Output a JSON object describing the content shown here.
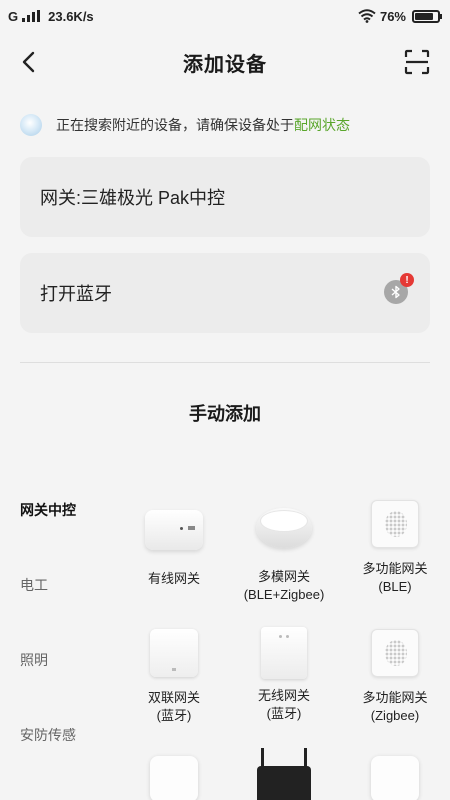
{
  "status_bar": {
    "carrier": "G",
    "speed": "23.6K/s",
    "battery": "76%",
    "battery_level": 0.76
  },
  "header": {
    "title": "添加设备",
    "back_icon": "chevron-left-icon",
    "scan_icon": "scan-icon"
  },
  "search": {
    "text": "正在搜索附近的设备，请确保设备处于",
    "link": "配网状态",
    "link_color": "#5aa62c"
  },
  "gateway_card": {
    "label": "网关:三雄极光 Pak中控"
  },
  "bluetooth_card": {
    "label": "打开蓝牙",
    "icon": "bluetooth-off-icon",
    "alert": "!",
    "alert_color": "#e53935"
  },
  "manual_add": {
    "title": "手动添加"
  },
  "categories": [
    {
      "label": "网关中控",
      "active": true
    },
    {
      "label": "电工",
      "active": false
    },
    {
      "label": "照明",
      "active": false
    },
    {
      "label": "安防传感",
      "active": false
    }
  ],
  "devices": [
    {
      "name": "有线网关",
      "icon": "wired-gateway-icon"
    },
    {
      "name": "多模网关\n(BLE+Zigbee)",
      "icon": "multimode-gateway-icon"
    },
    {
      "name": "多功能网关\n(BLE)",
      "icon": "multifunction-gateway-icon"
    },
    {
      "name": "双联网关\n(蓝牙)",
      "icon": "dual-gateway-icon"
    },
    {
      "name": "无线网关\n(蓝牙)",
      "icon": "wireless-gateway-icon"
    },
    {
      "name": "多功能网关\n(Zigbee)",
      "icon": "multifunction-gateway-icon"
    },
    {
      "name": "",
      "icon": "square-hub-icon"
    },
    {
      "name": "",
      "icon": "range-extender-icon"
    },
    {
      "name": "",
      "icon": "mesh-panel-icon"
    }
  ]
}
